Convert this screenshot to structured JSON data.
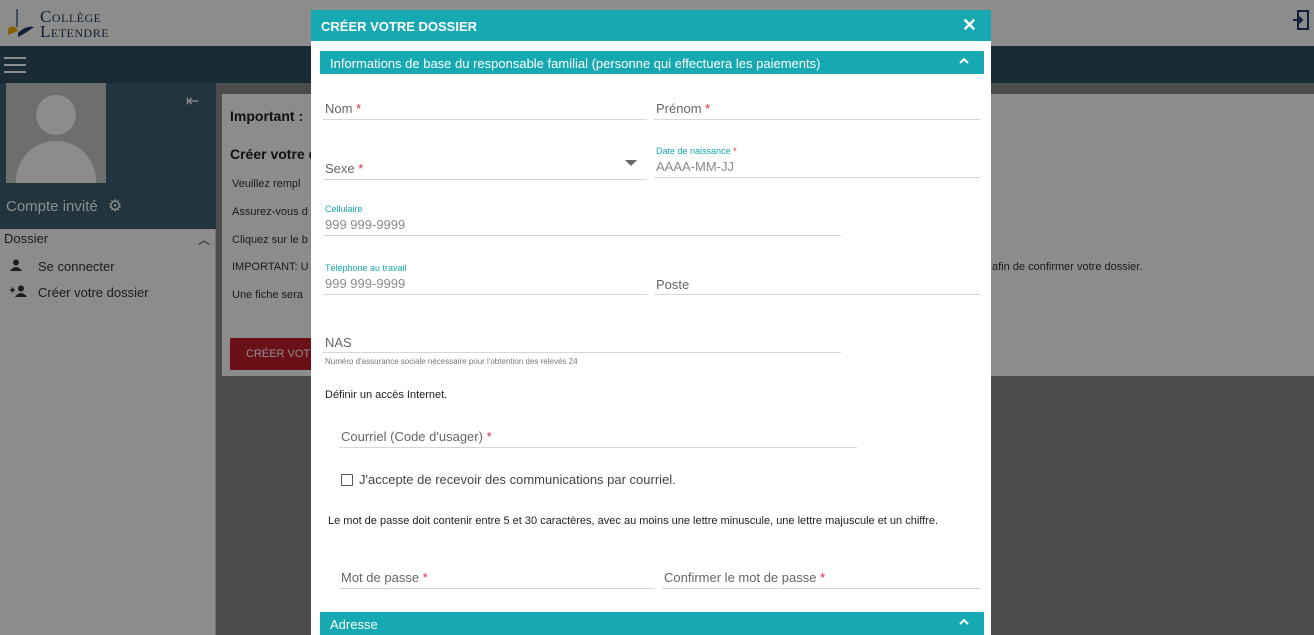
{
  "app": {
    "logo_line1": "Collège",
    "logo_line2": "Letendre",
    "colors": {
      "teal": "#17a9b1",
      "navy": "#2f4f61",
      "red": "#c0202b",
      "required": "#d32f2f"
    }
  },
  "sidebar": {
    "guest_label": "Compte invité",
    "section_label": "Dossier",
    "items": [
      {
        "label": "Se connecter",
        "icon": "person-icon"
      },
      {
        "label": "Créer votre dossier",
        "icon": "add-person-icon"
      }
    ]
  },
  "background": {
    "important": "Important :",
    "heading": "Créer votre d",
    "lines": [
      "Veuillez rempl",
      "Assurez-vous d",
      "Cliquez sur le b",
      "IMPORTANT: U",
      "Une fiche sera"
    ],
    "right_text": "afin de confirmer votre dossier.",
    "button": "CRÉER VOT"
  },
  "modal": {
    "title": "CRÉER VOTRE DOSSIER",
    "section1": "Informations de base du responsable familial (personne qui effectuera les paiements)",
    "nom": "Nom",
    "prenom": "Prénom",
    "sexe": "Sexe",
    "dob_label": "Date de naissance",
    "dob_placeholder": "AAAA-MM-JJ",
    "cell_label": "Cellulaire",
    "cell_placeholder": "999 999-9999",
    "work_label": "Téléphone au travail",
    "work_placeholder": "999 999-9999",
    "poste": "Poste",
    "nas": "NAS",
    "nas_helper": "Numéro d'assurance sociale nécessaire pour l'obtention des relevés 24",
    "internet": "Définir un accès Internet.",
    "email": "Courriel (Code d'usager)",
    "consent": "J'accepte de recevoir des communications par courriel.",
    "pw_note": "Le mot de passe doit contenir entre 5 et 30 caractères, avec au moins une lettre minuscule, une lettre majuscule et un chiffre.",
    "password": "Mot de passe",
    "confirm_password": "Confirmer le mot de passe",
    "section2": "Adresse",
    "required_mark": "*"
  }
}
